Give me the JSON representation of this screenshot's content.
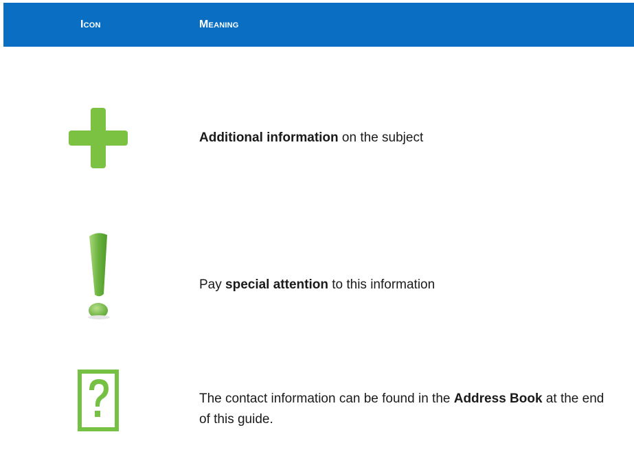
{
  "header": {
    "icon_label": "Icon",
    "meaning_label": "Meaning",
    "background_color": "#0a6fc2"
  },
  "rows": [
    {
      "icon": "plus-icon",
      "icon_color": "#7cc242",
      "text_bold": "Additional information",
      "text_rest": " on the subject"
    },
    {
      "icon": "exclamation-icon",
      "icon_color": "#6cb33f",
      "text_pre": "Pay ",
      "text_bold": "special attention",
      "text_rest": " to this information"
    },
    {
      "icon": "question-box-icon",
      "icon_color": "#76c043",
      "text_pre": "The contact information can be found in the ",
      "text_bold": "Address Book",
      "text_rest": " at the end of this guide."
    }
  ]
}
